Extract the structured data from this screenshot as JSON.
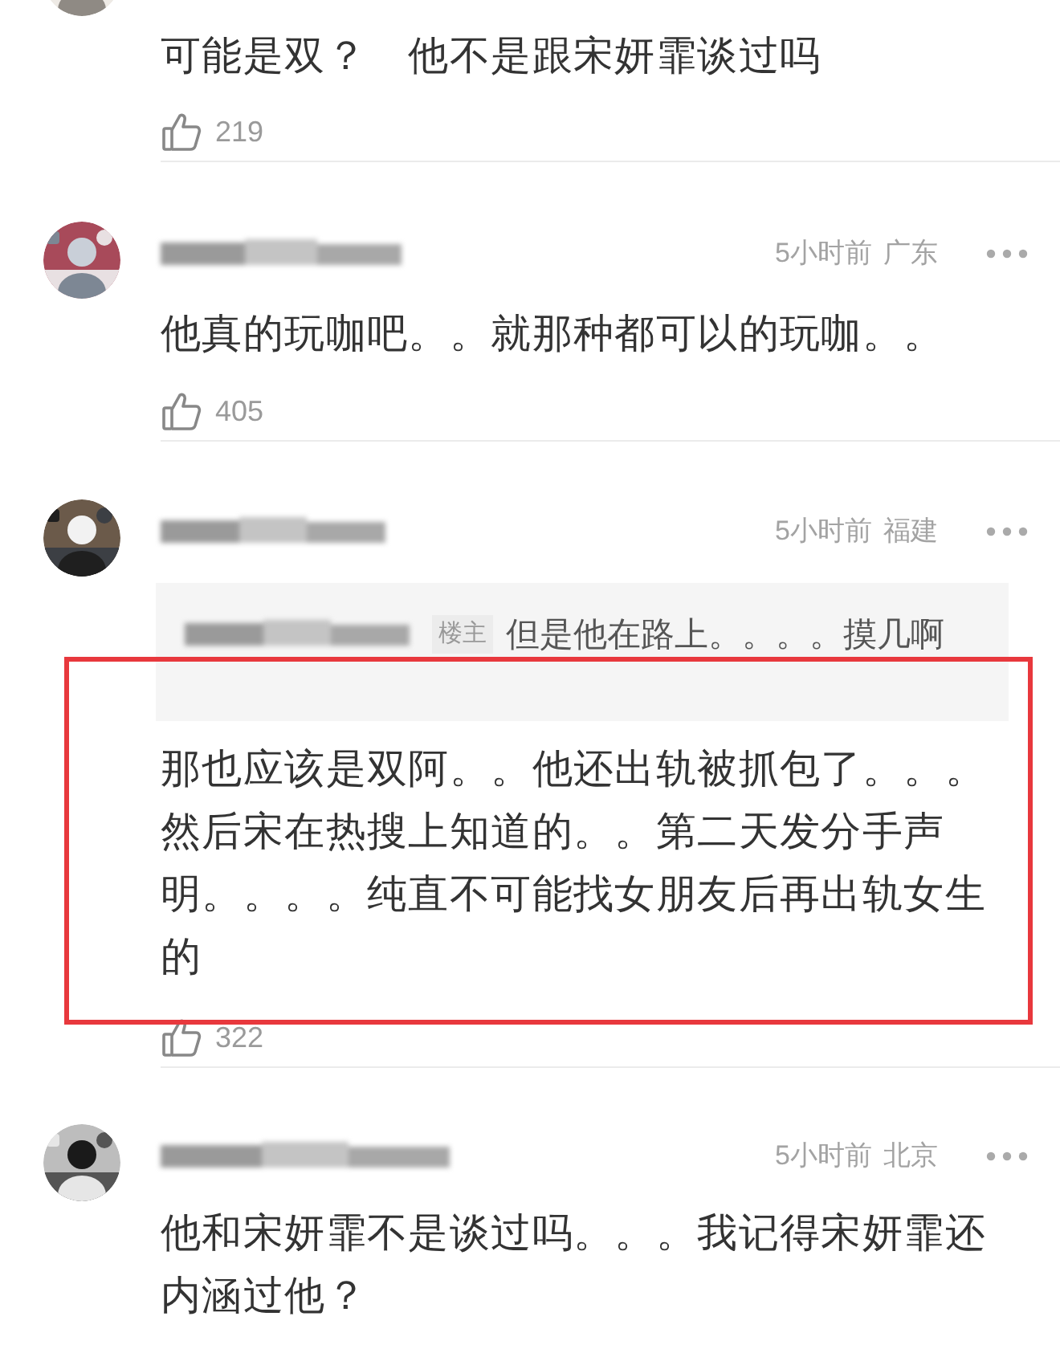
{
  "comments": [
    {
      "text": "可能是双？　他不是跟宋妍霏谈过吗",
      "likes": "219",
      "highlighted": false
    },
    {
      "time": "5小时前",
      "location": "广东",
      "text": "他真的玩咖吧。。就那种都可以的玩咖。。",
      "likes": "405",
      "highlighted": false
    },
    {
      "time": "5小时前",
      "location": "福建",
      "reply": {
        "badge": "楼主",
        "text": "但是他在路上。。。。摸几啊"
      },
      "text": "那也应该是双阿。。他还出轨被抓包了。。。然后宋在热搜上知道的。。第二天发分手声明。。。。纯直不可能找女朋友后再出轨女生的",
      "likes": "322",
      "highlighted": true
    },
    {
      "time": "5小时前",
      "location": "北京",
      "text": "他和宋妍霏不是谈过吗。。。我记得宋妍霏还内涵过他？",
      "highlighted": false
    }
  ]
}
